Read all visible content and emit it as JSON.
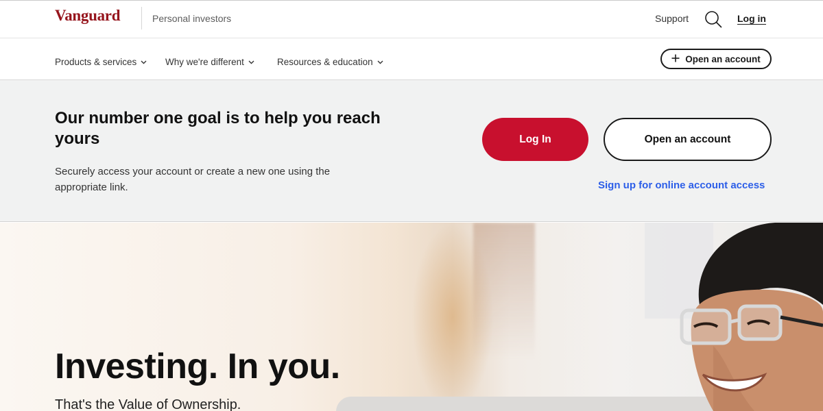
{
  "header": {
    "logo_text": "Vanguard",
    "section_label": "Personal investors",
    "support_label": "Support",
    "search_icon": "search-icon",
    "login_label": "Log in"
  },
  "nav": {
    "items": [
      {
        "label": "Products & services"
      },
      {
        "label": "Why we're different"
      },
      {
        "label": "Resources & education"
      }
    ],
    "open_account_label": "Open an account"
  },
  "login_band": {
    "title": "Our number one goal is to help you reach yours",
    "description": "Securely access your account or create a new one using the appropriate link.",
    "login_button": "Log In",
    "open_account_button": "Open an account",
    "signup_link": "Sign up for online account access"
  },
  "hero": {
    "title": "Investing. In you.",
    "subtitle": "That's the Value of Ownership."
  },
  "colors": {
    "brand_red": "#96151d",
    "button_red": "#c8102e",
    "link_blue": "#2c5ee8",
    "band_bg": "#f1f2f2"
  }
}
